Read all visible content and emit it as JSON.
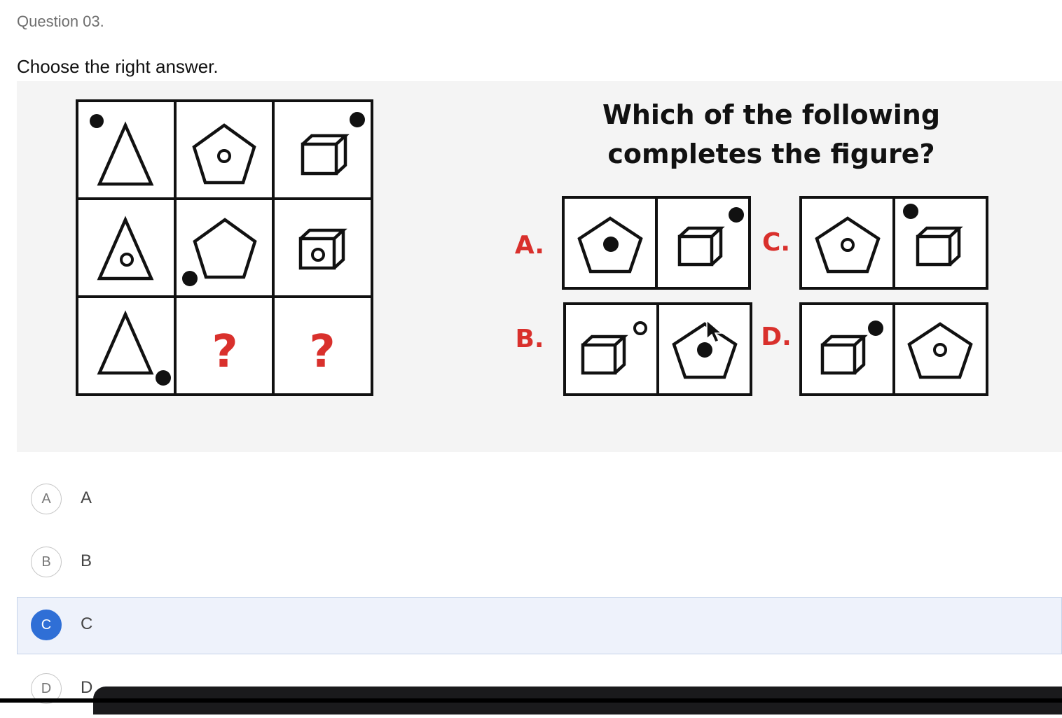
{
  "question": {
    "number_label": "Question 03.",
    "prompt": "Choose the right answer."
  },
  "figure": {
    "title_lines": [
      "Which of the following",
      "completes the figure?"
    ],
    "grid_unknown": "?",
    "option_letters": [
      "A.",
      "B.",
      "C.",
      "D."
    ]
  },
  "choices": [
    {
      "circle": "A",
      "label": "A",
      "selected": false
    },
    {
      "circle": "B",
      "label": "B",
      "selected": false
    },
    {
      "circle": "C",
      "label": "C",
      "selected": true
    },
    {
      "circle": "D",
      "label": "D",
      "selected": false
    }
  ],
  "colors": {
    "accent": "#2f6fd6",
    "option_letter": "#d9302c",
    "selected_row_bg": "#eef2fb"
  }
}
